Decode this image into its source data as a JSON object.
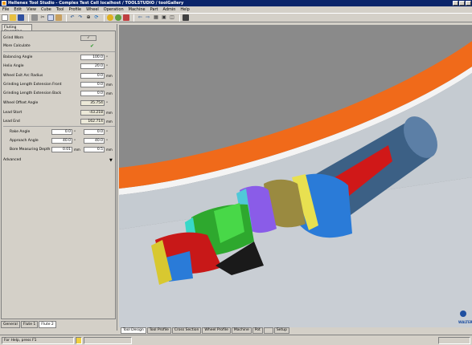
{
  "window": {
    "title": "Hellenex Tool Studio - Complex Test Cell    localhost / TOOLSTUDIO / toolGallery"
  },
  "menu": [
    "File",
    "Edit",
    "View",
    "Cube",
    "Tool",
    "Profile",
    "Wheel",
    "Operation",
    "Machine",
    "Part",
    "Admin",
    "Help"
  ],
  "left_panel": {
    "tab_label": "Fluting Operating",
    "rows": [
      {
        "label": "Grind Worn",
        "value": "✓",
        "unit": ""
      },
      {
        "label": "More Calculate",
        "value": "✔",
        "unit": ""
      },
      {
        "label": "Balancing Angle",
        "value": "100.0",
        "unit": "°"
      },
      {
        "label": "Helix Angle",
        "value": "20.0",
        "unit": "°"
      },
      {
        "label": "Wheel Exit Arc Radius",
        "value": "0.0",
        "unit": "mm"
      },
      {
        "label": "Grinding Length Extension Front",
        "value": "0.0",
        "unit": "mm"
      },
      {
        "label": "Grinding Length Extension Back",
        "value": "0.0",
        "unit": "mm"
      },
      {
        "label": "Wheel Offset Angle",
        "value": "35.754",
        "unit": "°"
      },
      {
        "label": "Lead Start",
        "value": "-43.218",
        "unit": "mm"
      },
      {
        "label": "Lead End",
        "value": "162.714",
        "unit": "mm"
      }
    ],
    "dual_rows": [
      {
        "label": "Rake Angle",
        "value1": "0.0",
        "unit1": "°",
        "value2": "0.0",
        "unit2": "°"
      },
      {
        "label": "Approach Angle",
        "value1": "40.0",
        "unit1": "°",
        "value2": "40.0",
        "unit2": "°"
      },
      {
        "label": "Bore Measuring Depth",
        "value1": "0.01",
        "unit1": "mm",
        "value2": "0.5",
        "unit2": "mm"
      }
    ],
    "advanced_label": "Advanced",
    "bottom_tabs": [
      "General",
      "Flute 1",
      "Flute 2"
    ]
  },
  "viewport_tabs": [
    "Tool Design",
    "Tool Profile",
    "Cross Section",
    "Wheel Profile",
    "Machine",
    "Pot",
    "",
    "Setup"
  ],
  "status": {
    "left": "For Help, press F1",
    "right": ""
  },
  "colors": {
    "orange_band": "#f06a1a",
    "shaft": "#3b5f82",
    "background_gray": "#8c8c8c",
    "floor": "#c8cdd2"
  },
  "icons": [
    "new-icon",
    "open-icon",
    "save-icon",
    "print-icon",
    "cut-icon",
    "copy-icon",
    "paste-icon",
    "undo-icon",
    "redo-icon",
    "zoom-icon",
    "rotate-icon",
    "render-icon",
    "camera-icon"
  ]
}
